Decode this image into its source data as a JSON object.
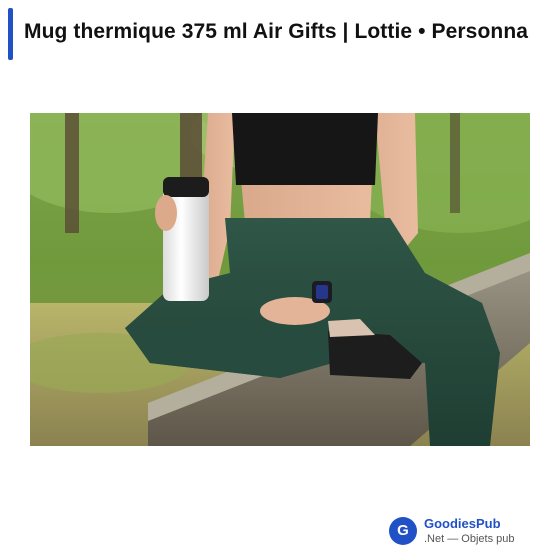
{
  "header": {
    "title": "Mug thermique 375 ml Air Gifts | Lottie • Personna"
  },
  "product_image": {
    "alt": "Mug thermique 375 ml Air Gifts | Lottie"
  },
  "brand": {
    "logo_letter": "G",
    "name": "GoodiesPub",
    "tagline": ".Net — Objets pub"
  },
  "colors": {
    "accent": "#2151c7"
  }
}
